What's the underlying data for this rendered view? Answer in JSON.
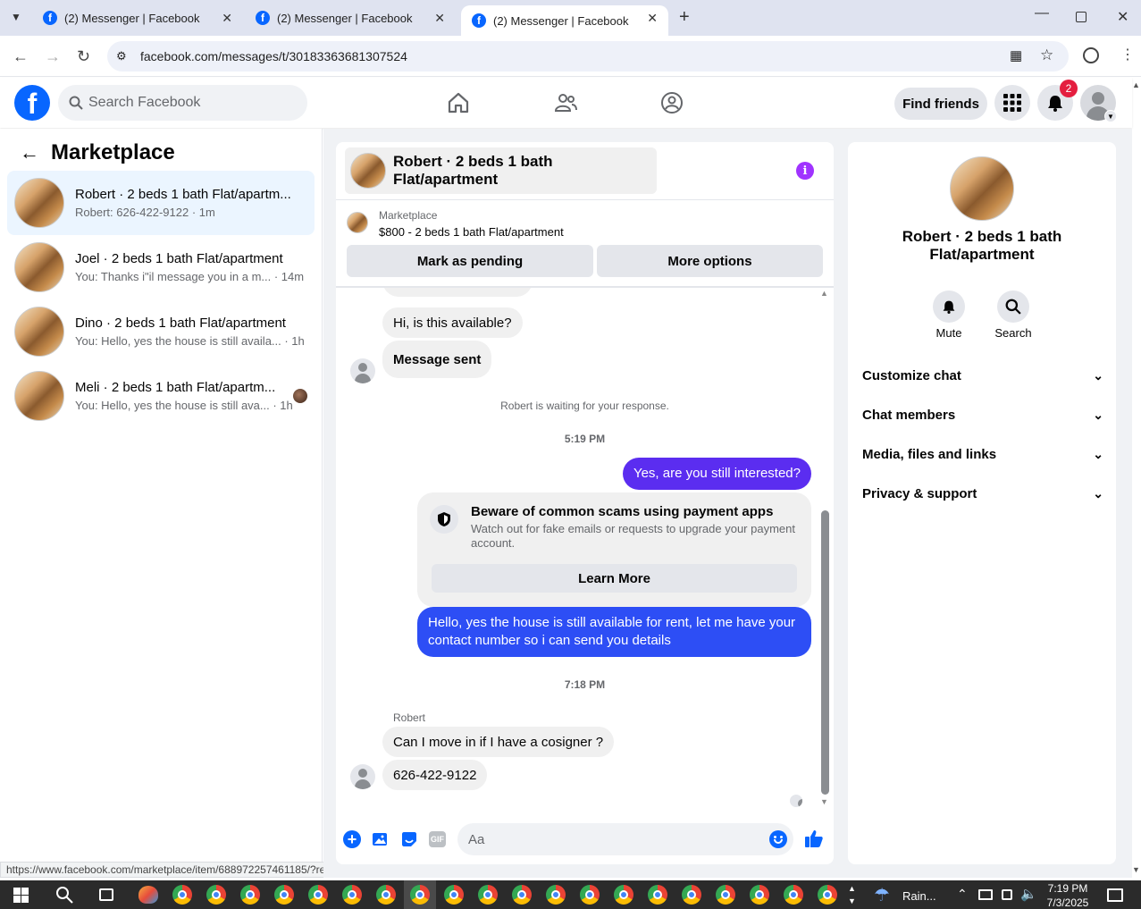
{
  "browser": {
    "tabs": [
      {
        "title": "(2) Messenger | Facebook"
      },
      {
        "title": "(2) Messenger | Facebook"
      },
      {
        "title": "(2) Messenger | Facebook"
      }
    ],
    "url": "facebook.com/messages/t/30183363681307524",
    "status_url": "https://www.facebook.com/marketplace/item/688972257461185/?referralSu..."
  },
  "header": {
    "search_placeholder": "Search Facebook",
    "find_friends": "Find friends",
    "notification_count": "2"
  },
  "sidebar": {
    "title": "Marketplace",
    "conversations": [
      {
        "name": "Robert · 2 beds 1 bath Flat/apartm...",
        "preview": "Robert: 626-422-9122 · 1m"
      },
      {
        "name": "Joel · 2 beds 1 bath Flat/apartment",
        "preview": "You: Thanks i\"il message you in a m... · 14m"
      },
      {
        "name": "Dino · 2 beds 1 bath Flat/apartment",
        "preview": "You: Hello, yes the house is still availa... · 1h"
      },
      {
        "name": "Meli · 2 beds 1 bath Flat/apartm...",
        "preview": "You: Hello, yes the house is still ava... · 1h"
      }
    ]
  },
  "chat": {
    "title": "Robert · 2 beds 1 bath Flat/apartment",
    "listing_label": "Marketplace",
    "listing_desc": "$800 - 2 beds 1 bath Flat/apartment",
    "mark_pending": "Mark as pending",
    "more_options": "More options",
    "messages": {
      "m1": "Hi, is this available?",
      "m2": "Message sent",
      "waiting": "Robert is waiting for your response.",
      "time1": "5:19 PM",
      "mine1": "Yes, are you still interested?",
      "scam_title": "Beware of common scams using payment apps",
      "scam_body": "Watch out for fake emails or requests to upgrade your payment account.",
      "learn_more": "Learn More",
      "mine2": "Hello, yes the house is still available for rent, let me have your contact number so i can send you details",
      "time2": "7:18 PM",
      "sender": "Robert",
      "m3": "Can I move in if I have a cosigner ?",
      "m4": "626-422-9122"
    },
    "composer_placeholder": "Aa"
  },
  "details": {
    "name": "Robert · 2 beds 1 bath Flat/apartment",
    "mute": "Mute",
    "search": "Search",
    "sections": [
      "Customize chat",
      "Chat members",
      "Media, files and links",
      "Privacy & support"
    ]
  },
  "taskbar": {
    "weather": "Rain...",
    "time": "7:19 PM",
    "date": "7/3/2025"
  },
  "colors": {
    "accent": "#0866ff",
    "my_bubble": "#5b2df0",
    "info_icon": "#a033ff"
  }
}
